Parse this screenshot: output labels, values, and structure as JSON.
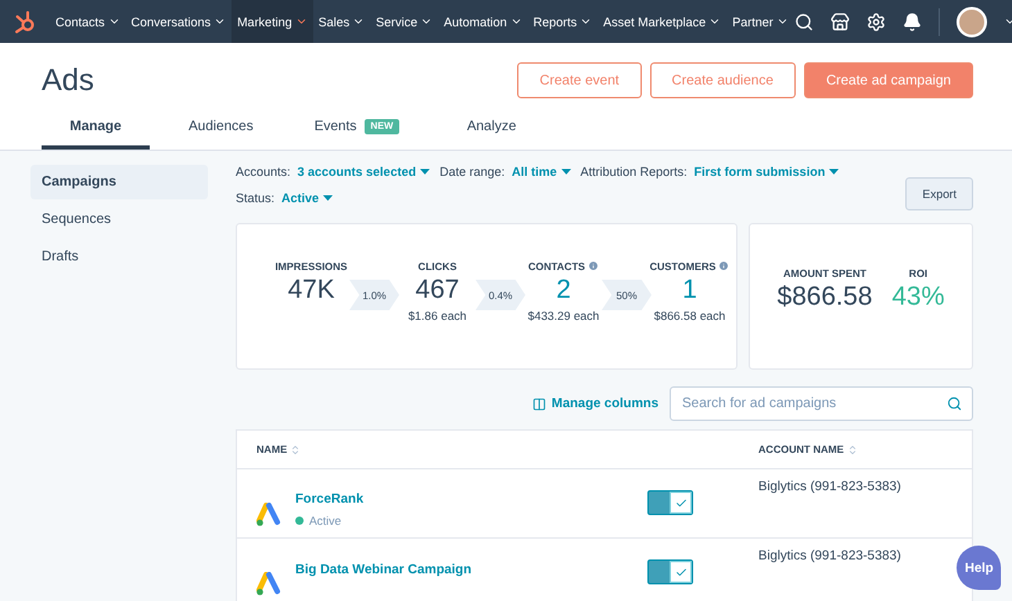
{
  "nav": {
    "items": [
      {
        "label": "Contacts",
        "selected": false
      },
      {
        "label": "Conversations",
        "selected": false
      },
      {
        "label": "Marketing",
        "selected": true
      },
      {
        "label": "Sales",
        "selected": false
      },
      {
        "label": "Service",
        "selected": false
      },
      {
        "label": "Automation",
        "selected": false
      },
      {
        "label": "Reports",
        "selected": false
      },
      {
        "label": "Asset Marketplace",
        "selected": false
      },
      {
        "label": "Partner",
        "selected": false
      }
    ]
  },
  "header": {
    "title": "Ads",
    "buttons": [
      {
        "label": "Create event",
        "kind": "outline"
      },
      {
        "label": "Create audience",
        "kind": "outline"
      },
      {
        "label": "Create ad campaign",
        "kind": "primary"
      }
    ]
  },
  "tabs": [
    {
      "label": "Manage",
      "selected": true
    },
    {
      "label": "Audiences",
      "selected": false
    },
    {
      "label": "Events",
      "selected": false,
      "badge": "NEW"
    },
    {
      "label": "Analyze",
      "selected": false
    }
  ],
  "sidebar": {
    "items": [
      {
        "label": "Campaigns",
        "selected": true
      },
      {
        "label": "Sequences",
        "selected": false
      },
      {
        "label": "Drafts",
        "selected": false
      }
    ]
  },
  "filters": [
    {
      "label": "Accounts:",
      "value": "3 accounts selected"
    },
    {
      "label": "Date range:",
      "value": "All time"
    },
    {
      "label": "Attribution Reports:",
      "value": "First form submission"
    },
    {
      "label": "Status:",
      "value": "Active"
    }
  ],
  "export_button": "Export",
  "funnel": [
    {
      "label": "IMPRESSIONS",
      "value": "47K",
      "info": false,
      "accent": false
    },
    {
      "rate": "1.0%",
      "label": "CLICKS",
      "value": "467",
      "sub": "$1.86 each",
      "info": false,
      "accent": false
    },
    {
      "rate": "0.4%",
      "label": "CONTACTS",
      "value": "2",
      "sub": "$433.29 each",
      "info": true,
      "accent": true
    },
    {
      "rate": "50%",
      "label": "CUSTOMERS",
      "value": "1",
      "sub": "$866.58 each",
      "info": true,
      "accent": true
    }
  ],
  "summary": [
    {
      "label": "AMOUNT SPENT",
      "value": "$866.58",
      "positive": false
    },
    {
      "label": "ROI",
      "value": "43%",
      "positive": true
    }
  ],
  "manage_columns": "Manage columns",
  "search": {
    "placeholder": "Search for ad campaigns"
  },
  "table": {
    "columns": [
      "NAME",
      "ACCOUNT NAME"
    ],
    "rows": [
      {
        "name": "ForceRank",
        "status": "Active",
        "on": true,
        "account": "Biglytics (991-823-5383)"
      },
      {
        "name": "Big Data Webinar Campaign",
        "on": true,
        "account": "Biglytics (991-823-5383)"
      }
    ]
  },
  "help_button": "Help"
}
